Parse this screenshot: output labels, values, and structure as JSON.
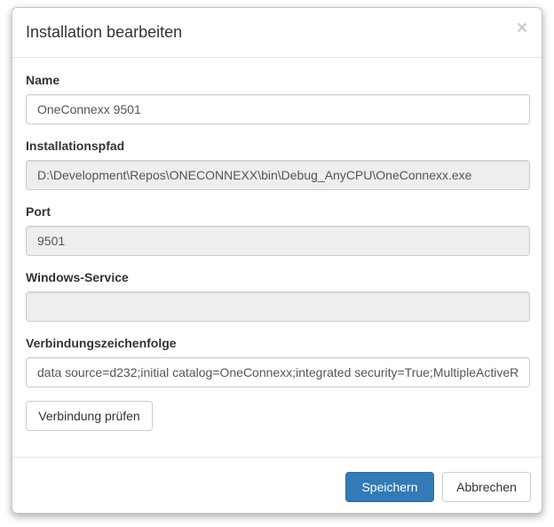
{
  "dialog": {
    "title": "Installation bearbeiten",
    "close_symbol": "×"
  },
  "fields": {
    "name": {
      "label": "Name",
      "value": "OneConnexx 9501"
    },
    "path": {
      "label": "Installationspfad",
      "value": "D:\\Development\\Repos\\ONECONNEXX\\bin\\Debug_AnyCPU\\OneConnexx.exe"
    },
    "port": {
      "label": "Port",
      "value": "9501"
    },
    "service": {
      "label": "Windows-Service",
      "value": ""
    },
    "connection": {
      "label": "Verbindungszeichenfolge",
      "value": "data source=d232;initial catalog=OneConnexx;integrated security=True;MultipleActiveResultSets=True"
    }
  },
  "buttons": {
    "test_connection": "Verbindung prüfen",
    "save": "Speichern",
    "cancel": "Abbrechen"
  },
  "colors": {
    "primary": "#337ab7",
    "readonly_bg": "#eeeeee",
    "border": "#cccccc"
  }
}
